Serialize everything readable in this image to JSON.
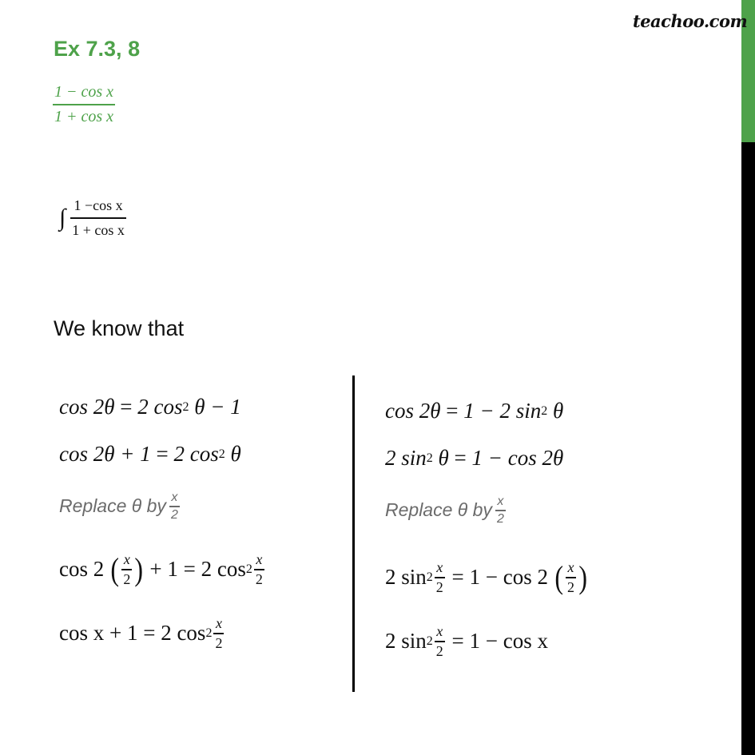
{
  "header": {
    "title": "Ex 7.3, 8",
    "brand": "teachoo.com",
    "question": {
      "numerator": "1 − cos x",
      "denominator": "1 + cos x"
    }
  },
  "integral": {
    "sign": "∫",
    "numerator": "1 −cos x",
    "denominator": "1 + cos x"
  },
  "intro_text": "We know that",
  "left_column": {
    "eq1": {
      "lhs": "cos 2θ",
      "op": "=",
      "rhs_a": "2 cos",
      "sup": "2",
      "rhs_b": "θ − 1"
    },
    "eq2": {
      "lhs": "cos 2θ + 1",
      "op": "=",
      "rhs_a": "2 cos",
      "sup": "2",
      "rhs_b": "θ"
    },
    "replace": {
      "text": "Replace θ by",
      "num": "x",
      "den": "2"
    },
    "eq3": {
      "lhs_a": "cos 2",
      "num": "x",
      "den": "2",
      "lhs_b": "+ 1",
      "op": "=",
      "rhs_a": "2 cos",
      "sup": "2",
      "rnum": "x",
      "rden": "2"
    },
    "eq4": {
      "lhs": "cos x + 1",
      "op": "=",
      "rhs_a": "2 cos",
      "sup": "2",
      "rnum": "x",
      "rden": "2"
    }
  },
  "right_column": {
    "eq1": {
      "lhs": "cos 2θ",
      "op": "=",
      "rhs_a": "1 − 2 sin",
      "sup": "2",
      "rhs_b": "θ"
    },
    "eq2": {
      "lhs_a": "2 sin",
      "sup": "2",
      "lhs_b": "θ",
      "op": "=",
      "rhs": "1 − cos 2θ"
    },
    "replace": {
      "text": "Replace θ by",
      "num": "x",
      "den": "2"
    },
    "eq3": {
      "lhs_a": "2 sin",
      "sup": "2",
      "lnum": "x",
      "lden": "2",
      "op": "=",
      "rhs_a": "1 − cos 2",
      "num": "x",
      "den": "2"
    },
    "eq4": {
      "lhs_a": "2 sin",
      "sup": "2",
      "lnum": "x",
      "lden": "2",
      "op": "=",
      "rhs": "1 − cos x"
    }
  },
  "colors": {
    "accent": "#4ea24a",
    "text": "#111111",
    "muted": "#6b6b6b",
    "scrollbar_track": "#000000"
  }
}
